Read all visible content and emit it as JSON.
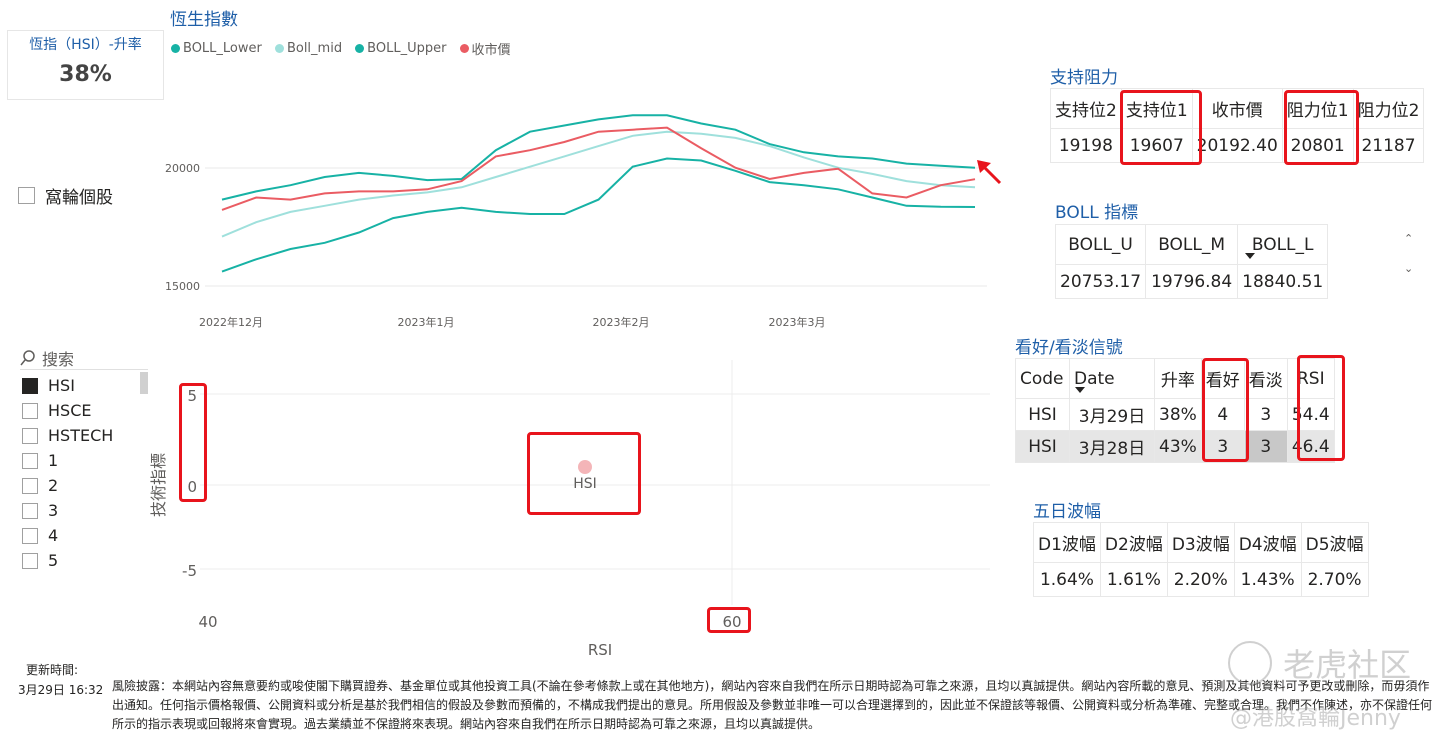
{
  "kpi": {
    "label": "恆指（HSI）-升率",
    "value": "38%"
  },
  "checkbox": {
    "label": "窩輪個股"
  },
  "hsi_chart": {
    "title": "恆生指數",
    "legend": [
      {
        "name": "BOLL_Lower",
        "color": "#17b2a5"
      },
      {
        "name": "Boll_mid",
        "color": "#9fe0dc"
      },
      {
        "name": "BOLL_Upper",
        "color": "#17b2a5"
      },
      {
        "name": "收市價",
        "color": "#ea5c63"
      }
    ],
    "y_ticks": [
      "20000",
      "15000"
    ],
    "x_ticks": [
      "2022年12月",
      "2023年1月",
      "2023年2月",
      "2023年3月"
    ]
  },
  "chart_data": {
    "type": "line",
    "title": "恆生指數",
    "x": [
      "2022-12-01",
      "2022-12-06",
      "2022-12-09",
      "2022-12-14",
      "2022-12-19",
      "2022-12-22",
      "2022-12-28",
      "2023-01-03",
      "2023-01-09",
      "2023-01-13",
      "2023-01-19",
      "2023-01-27",
      "2023-02-02",
      "2023-02-08",
      "2023-02-14",
      "2023-02-20",
      "2023-02-24",
      "2023-03-02",
      "2023-03-08",
      "2023-03-14",
      "2023-03-20",
      "2023-03-24",
      "2023-03-29"
    ],
    "ylim": [
      15000,
      25500
    ],
    "series": [
      {
        "name": "BOLL_Upper",
        "values": [
          19200,
          19600,
          19900,
          20300,
          20500,
          20350,
          20150,
          20200,
          21600,
          22500,
          22800,
          23100,
          23300,
          23300,
          22900,
          22600,
          21900,
          21500,
          21300,
          21200,
          20950,
          20850,
          20750
        ]
      },
      {
        "name": "Boll_mid",
        "values": [
          17400,
          18100,
          18600,
          18900,
          19200,
          19400,
          19550,
          19800,
          20300,
          20800,
          21300,
          21800,
          22300,
          22500,
          22400,
          22200,
          21800,
          21250,
          20750,
          20450,
          20100,
          19900,
          19800
        ]
      },
      {
        "name": "BOLL_Lower",
        "values": [
          15700,
          16300,
          16800,
          17100,
          17600,
          18300,
          18600,
          18800,
          18600,
          18500,
          18500,
          19200,
          20800,
          21200,
          21100,
          20600,
          20050,
          19900,
          19700,
          19300,
          18900,
          18850,
          18840
        ]
      },
      {
        "name": "收市價",
        "values": [
          18700,
          19300,
          19200,
          19500,
          19600,
          19600,
          19700,
          20100,
          21300,
          21600,
          22000,
          22500,
          22600,
          22700,
          21700,
          20750,
          20200,
          20500,
          20700,
          19500,
          19300,
          19900,
          20192
        ]
      }
    ]
  },
  "support": {
    "title": "支持阻力",
    "headers": [
      "支持位2",
      "支持位1",
      "收市價",
      "阻力位1",
      "阻力位2"
    ],
    "values": [
      "19198",
      "19607",
      "20192.40",
      "20801",
      "21187"
    ]
  },
  "boll": {
    "title": "BOLL 指標",
    "headers": [
      "BOLL_U",
      "BOLL_M",
      "BOLL_L"
    ],
    "values": [
      "20753.17",
      "19796.84",
      "18840.51"
    ]
  },
  "signal": {
    "title": "看好/看淡信號",
    "headers": [
      "Code",
      "Date",
      "升率",
      "看好",
      "看淡",
      "RSI"
    ],
    "rows": [
      [
        "HSI",
        "3月29日",
        "38%",
        "4",
        "3",
        "54.4"
      ],
      [
        "HSI",
        "3月28日",
        "43%",
        "3",
        "3",
        "46.4"
      ]
    ]
  },
  "wave": {
    "title": "五日波幅",
    "headers": [
      "D1波幅",
      "D2波幅",
      "D3波幅",
      "D4波幅",
      "D5波幅"
    ],
    "values": [
      "1.64%",
      "1.61%",
      "2.20%",
      "1.43%",
      "2.70%"
    ]
  },
  "slicer": {
    "search_placeholder": "搜索",
    "items": [
      "HSI",
      "HSCE",
      "HSTECH",
      "1",
      "2",
      "3",
      "4",
      "5"
    ]
  },
  "scatter": {
    "y_label": "技術指標",
    "x_label": "RSI",
    "y_ticks": [
      "5",
      "0",
      "-5"
    ],
    "x_ticks": [
      "40",
      "60"
    ],
    "point_label": "HSI"
  },
  "footer": {
    "update_label": "更新時間:",
    "update_time": "3月29日 16:32",
    "disclaimer": "風險披露：本網站內容無意要約或唆使閣下購買證券、基金單位或其他投資工具(不論在參考條款上或在其他地方)，網站內容來自我們在所示日期時認為可靠之來源，且均以真誠提供。網站內容所載的意見、預測及其他資料可予更改或刪除，而毋須作出通知。任何指示價格報價、公開資料或分析是基於我們相信的假設及參數而預備的，不構成我們提出的意見。所用假設及參數並非唯一可以合理選擇到的，因此並不保證該等報價、公開資料或分析為準確、完整或合理。我們不作陳述，亦不保證任何所示的指示表現或回報將來會實現。過去業績並不保證將來表現。網站內容來自我們在所示日期時認為可靠之來源，且均以真誠提供。"
  },
  "watermark": {
    "text": "老虎社区",
    "sub": "@港股窩輪Jenny"
  }
}
